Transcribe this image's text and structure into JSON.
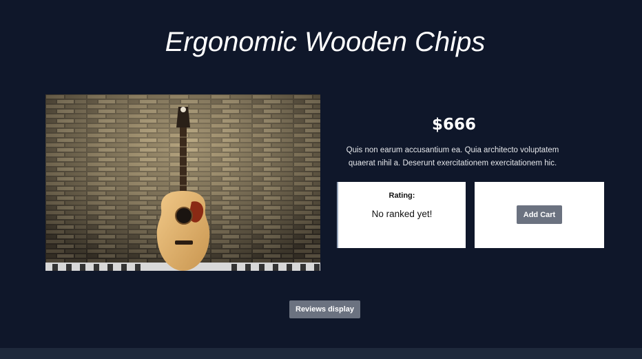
{
  "product": {
    "title": "Ergonomic Wooden Chips",
    "price": "$666",
    "description": "Quis non earum accusantium ea. Quia architecto voluptatem quaerat nihil a. Deserunt exercitationem exercitationem hic.",
    "image_subject": "acoustic-guitar-against-stone-wall"
  },
  "rating": {
    "label": "Rating:",
    "value": "No ranked yet!"
  },
  "actions": {
    "add_cart_label": "Add Cart",
    "reviews_label": "Reviews display"
  },
  "colors": {
    "background": "#0f172a",
    "button": "#6b7280",
    "card": "#ffffff",
    "footer": "#1e293b"
  }
}
